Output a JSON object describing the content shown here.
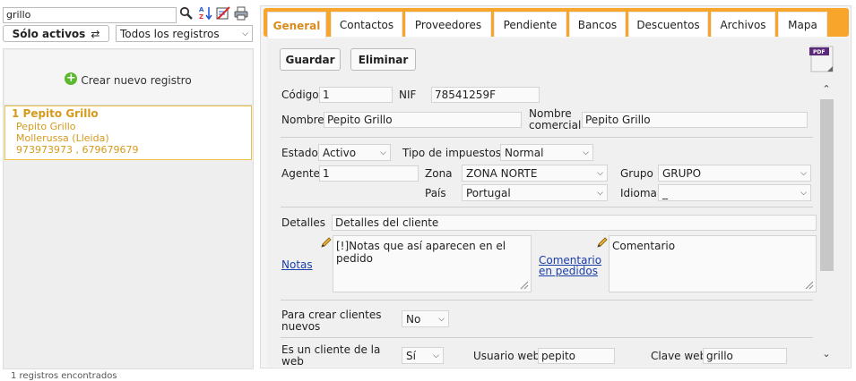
{
  "search": {
    "value": "grillo"
  },
  "filters": {
    "solo_activos_label": "Sólo activos",
    "swap_symbol": "⇄",
    "registros_selected": "Todos los registros"
  },
  "sidebar": {
    "crear_label": "Crear nuevo registro",
    "record": {
      "title": "1 Pepito Grillo",
      "name": "Pepito Grillo",
      "location": "Mollerussa (Lleida)",
      "phones": "973973973 , 679679679"
    },
    "count_text": "1 registros encontrados"
  },
  "tabs": [
    {
      "label": "General"
    },
    {
      "label": "Contactos"
    },
    {
      "label": "Proveedores"
    },
    {
      "label": "Pendiente"
    },
    {
      "label": "Bancos"
    },
    {
      "label": "Descuentos"
    },
    {
      "label": "Archivos"
    },
    {
      "label": "Mapa"
    }
  ],
  "toolbar": {
    "guardar": "Guardar",
    "eliminar": "Eliminar",
    "pdf_text": "PDF"
  },
  "form": {
    "codigo": {
      "label": "Código",
      "value": "1"
    },
    "nif": {
      "label": "NIF",
      "value": "78541259F"
    },
    "nombre": {
      "label": "Nombre",
      "value": "Pepito Grillo"
    },
    "nombre_comercial": {
      "label_1": "Nombre",
      "label_2": "comercial",
      "value": "Pepito Grillo"
    },
    "estado": {
      "label": "Estado",
      "value": "Activo"
    },
    "tipo_impuestos": {
      "label": "Tipo de impuestos",
      "value": "Normal"
    },
    "agente": {
      "label": "Agente",
      "value": "1"
    },
    "zona": {
      "label": "Zona",
      "value": "ZONA NORTE"
    },
    "grupo": {
      "label": "Grupo",
      "value": "GRUPO"
    },
    "pais": {
      "label": "País",
      "value": "Portugal"
    },
    "idioma": {
      "label": "Idioma",
      "value": "_"
    },
    "detalles": {
      "label": "Detalles",
      "value": "Detalles del cliente"
    },
    "notas": {
      "label": "Notas",
      "value": "[!]Notas que así aparecen en el pedido"
    },
    "comentario": {
      "label_1": "Comentario",
      "label_2": "en pedidos",
      "value": "Comentario"
    },
    "crear_clientes": {
      "label_1": "Para crear clientes",
      "label_2": "nuevos",
      "value": "No"
    },
    "es_cliente_web": {
      "label_1": "Es un cliente de la",
      "label_2": "web",
      "value": "Sí"
    },
    "usuario_web": {
      "label": "Usuario web",
      "value": "pepito"
    },
    "clave_web": {
      "label": "Clave web",
      "value": "grillo"
    }
  },
  "colors": {
    "accent": "#f8a52c",
    "record_text": "#d69a1c",
    "link": "#1a3ea8"
  }
}
